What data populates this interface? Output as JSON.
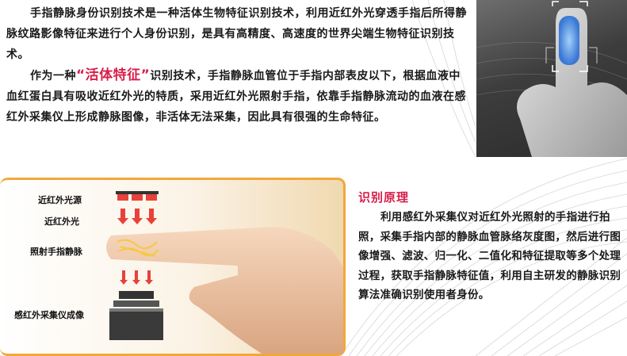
{
  "intro": {
    "paragraph1": "手指静脉身份识别技术是一种活体生物特征识别技术，利用近红外光穿透手指后所得静脉纹路影像特征来进行个人身份识别，是具有高精度、高速度的世界尖端生物特征识别技术。",
    "paragraph2_before": "作为一种",
    "paragraph2_highlight": "“活体特征”",
    "paragraph2_after": "识别技术，手指静脉血管位于手指内部表皮以下，根据血液中血红蛋白具有吸收近红外光的特质，采用近红外光照射手指，依靠手指静脉流动的血液在感红外采集仪上形成静脉图像，非活体无法采集，因此具有很强的生命特征。"
  },
  "diagram": {
    "labels": {
      "ir_source": "近红外光源",
      "ir_light": "近红外光",
      "finger_vein": "照射手指静脉",
      "sensor": "感红外采集仪成像"
    }
  },
  "principle": {
    "title": "识别原理",
    "body": "利用感红外采集仪对近红外光照射的手指进行拍照，采集手指内部的静脉血管脉络灰度图，然后进行图像增强、滤波、归一化、二值化和特征提取等多个处理过程，获取手指静脉特征值，利用自主研发的静脉识别算法准确识别使用者身份。"
  },
  "colors": {
    "accent_red": "#d81e4a",
    "panel_border": "#f2a73a",
    "ir_arrow": "#e8413a",
    "vein_gold": "#f7c842",
    "scan_blue": "#3a8fe8"
  }
}
